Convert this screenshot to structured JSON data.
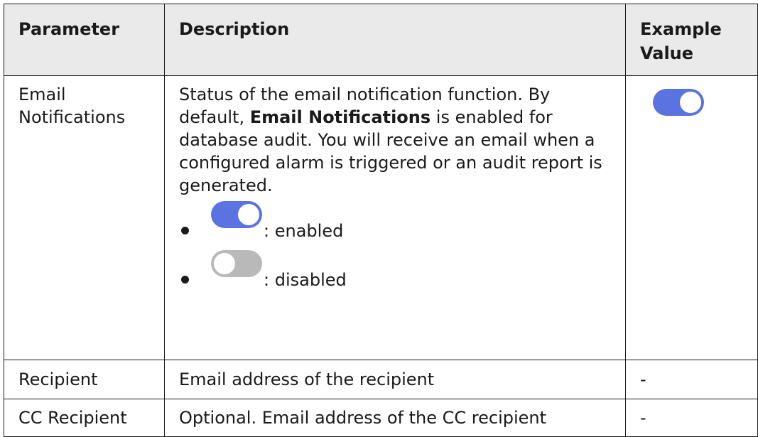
{
  "table": {
    "headers": {
      "parameter": "Parameter",
      "description": "Description",
      "example_line1": "Example",
      "example_line2": "Value"
    },
    "rows": [
      {
        "parameter_line1": "Email",
        "parameter_line2": "Notifications",
        "description": {
          "intro": "Status of the email notification function. By default, ",
          "bold": "Email Notifications",
          "rest": " is enabled for database audit. You will receive an email when a configured alarm is triggered or an audit report is generated."
        },
        "bullets": [
          {
            "label": ": enabled",
            "toggle_state": "on"
          },
          {
            "label": ": disabled",
            "toggle_state": "off"
          }
        ],
        "example_toggle_state": "on"
      },
      {
        "parameter": "Recipient",
        "description": "Email address of the recipient",
        "example": "-"
      },
      {
        "parameter": "CC Recipient",
        "description": "Optional. Email address of the CC recipient",
        "example": "-"
      }
    ]
  },
  "colors": {
    "toggle_on": "#5b73e0",
    "toggle_off": "#b9b9b9",
    "header_bg": "#eaeaea",
    "border": "#1a1a1a"
  }
}
